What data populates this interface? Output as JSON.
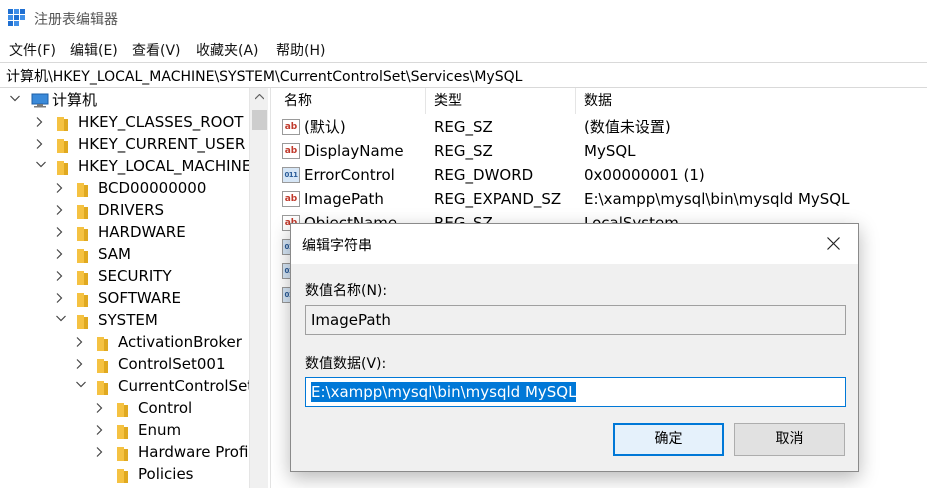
{
  "window": {
    "title": "注册表编辑器",
    "icon": "registry-editor-icon"
  },
  "menu": [
    "文件(F)",
    "编辑(E)",
    "查看(V)",
    "收藏夹(A)",
    "帮助(H)"
  ],
  "address": "计算机\\HKEY_LOCAL_MACHINE\\SYSTEM\\CurrentControlSet\\Services\\MySQL",
  "tree": [
    {
      "label": "计算机",
      "level": 0,
      "state": "expanded",
      "icon": "computer-icon"
    },
    {
      "label": "HKEY_CLASSES_ROOT",
      "level": 1,
      "state": "collapsed",
      "icon": "folder-icon"
    },
    {
      "label": "HKEY_CURRENT_USER",
      "level": 1,
      "state": "collapsed",
      "icon": "folder-icon"
    },
    {
      "label": "HKEY_LOCAL_MACHINE",
      "level": 1,
      "state": "expanded",
      "icon": "folder-icon"
    },
    {
      "label": "BCD00000000",
      "level": 2,
      "state": "collapsed",
      "icon": "folder-icon"
    },
    {
      "label": "DRIVERS",
      "level": 2,
      "state": "collapsed",
      "icon": "folder-icon"
    },
    {
      "label": "HARDWARE",
      "level": 2,
      "state": "collapsed",
      "icon": "folder-icon"
    },
    {
      "label": "SAM",
      "level": 2,
      "state": "collapsed",
      "icon": "folder-icon"
    },
    {
      "label": "SECURITY",
      "level": 2,
      "state": "collapsed",
      "icon": "folder-icon"
    },
    {
      "label": "SOFTWARE",
      "level": 2,
      "state": "collapsed",
      "icon": "folder-icon"
    },
    {
      "label": "SYSTEM",
      "level": 2,
      "state": "expanded",
      "icon": "folder-icon"
    },
    {
      "label": "ActivationBroker",
      "level": 3,
      "state": "collapsed",
      "icon": "folder-icon"
    },
    {
      "label": "ControlSet001",
      "level": 3,
      "state": "collapsed",
      "icon": "folder-icon"
    },
    {
      "label": "CurrentControlSet",
      "level": 3,
      "state": "expanded",
      "icon": "folder-icon"
    },
    {
      "label": "Control",
      "level": 4,
      "state": "collapsed",
      "icon": "folder-icon"
    },
    {
      "label": "Enum",
      "level": 4,
      "state": "collapsed",
      "icon": "folder-icon"
    },
    {
      "label": "Hardware Profile",
      "level": 4,
      "state": "collapsed",
      "icon": "folder-icon"
    },
    {
      "label": "Policies",
      "level": 4,
      "state": "leaf",
      "icon": "folder-icon"
    }
  ],
  "list": {
    "columns": [
      "名称",
      "类型",
      "数据"
    ],
    "rows": [
      {
        "name": "(默认)",
        "type": "REG_SZ",
        "data": "(数值未设置)",
        "icon": "string-value-icon"
      },
      {
        "name": "DisplayName",
        "type": "REG_SZ",
        "data": "MySQL",
        "icon": "string-value-icon"
      },
      {
        "name": "ErrorControl",
        "type": "REG_DWORD",
        "data": "0x00000001 (1)",
        "icon": "binary-value-icon"
      },
      {
        "name": "ImagePath",
        "type": "REG_EXPAND_SZ",
        "data": "E:\\xampp\\mysql\\bin\\mysqld MySQL",
        "icon": "string-value-icon"
      },
      {
        "name": "ObjectName",
        "type": "REG_SZ",
        "data": "LocalSystem",
        "icon": "string-value-icon"
      },
      {
        "name": "",
        "type": "",
        "data": "",
        "icon": "binary-value-icon"
      },
      {
        "name": "",
        "type": "",
        "data": "",
        "icon": "binary-value-icon"
      },
      {
        "name": "",
        "type": "",
        "data": "",
        "icon": "binary-value-icon"
      }
    ]
  },
  "dialog": {
    "title": "编辑字符串",
    "name_label": "数值名称(N):",
    "name_value": "ImagePath",
    "data_label": "数值数据(V):",
    "data_value": "E:\\xampp\\mysql\\bin\\mysqld MySQL",
    "ok": "确定",
    "cancel": "取消"
  },
  "colors": {
    "accent": "#0078d7",
    "folder": "#f5c242",
    "dialog_bg": "#f0f0f0"
  }
}
